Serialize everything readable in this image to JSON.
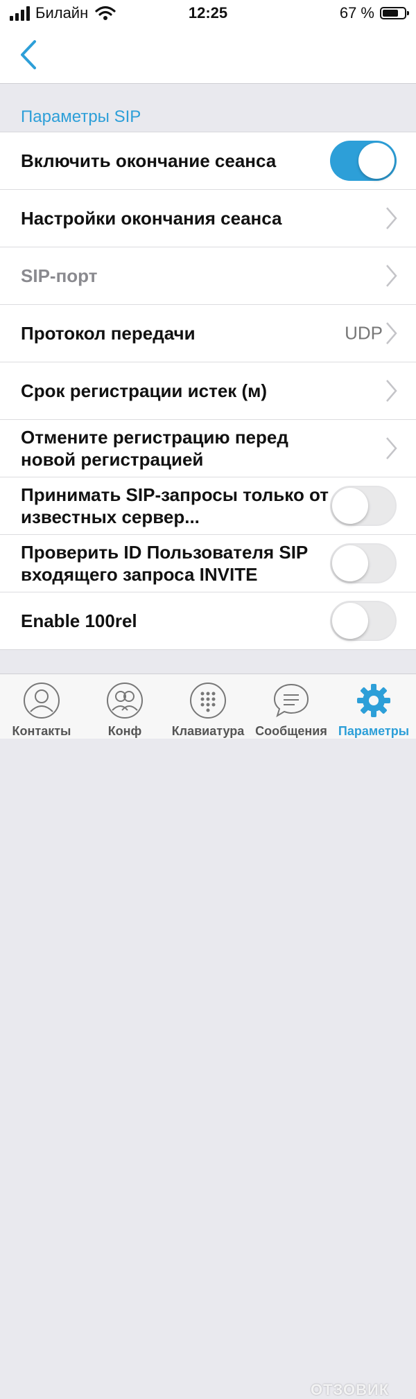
{
  "status_bar": {
    "carrier": "Билайн",
    "time": "12:25",
    "battery": "67 %"
  },
  "section": {
    "title": "Параметры SIP"
  },
  "rows": [
    {
      "label": "Включить окончание сеанса",
      "control": "toggle",
      "state": "on"
    },
    {
      "label": "Настройки окончания сеанса",
      "control": "chevron"
    },
    {
      "label": "SIP-порт",
      "control": "chevron",
      "disabled": true
    },
    {
      "label": "Протокол передачи",
      "control": "chevron",
      "value": "UDP"
    },
    {
      "label": "Срок регистрации истек (м)",
      "control": "chevron"
    },
    {
      "label": "Отмените регистрацию перед новой регистрацией",
      "control": "chevron"
    },
    {
      "label": "Принимать SIP-запросы только от известных сервер...",
      "control": "toggle",
      "state": "off"
    },
    {
      "label": "Проверить ID Пользователя SIP входящего запроса INVITE",
      "control": "toggle",
      "state": "off"
    },
    {
      "label": "Enable 100rel",
      "control": "toggle",
      "state": "off"
    }
  ],
  "tabs": [
    {
      "label": "Контакты",
      "icon": "person-icon"
    },
    {
      "label": "Конф",
      "icon": "group-icon"
    },
    {
      "label": "Клавиатура",
      "icon": "keypad-icon"
    },
    {
      "label": "Сообщения",
      "icon": "chat-icon"
    },
    {
      "label": "Параметры",
      "icon": "gear-icon",
      "active": true
    }
  ],
  "watermark": "ОТЗОВИК",
  "colors": {
    "accent": "#2d9fd8",
    "background": "#e9e9ee"
  }
}
